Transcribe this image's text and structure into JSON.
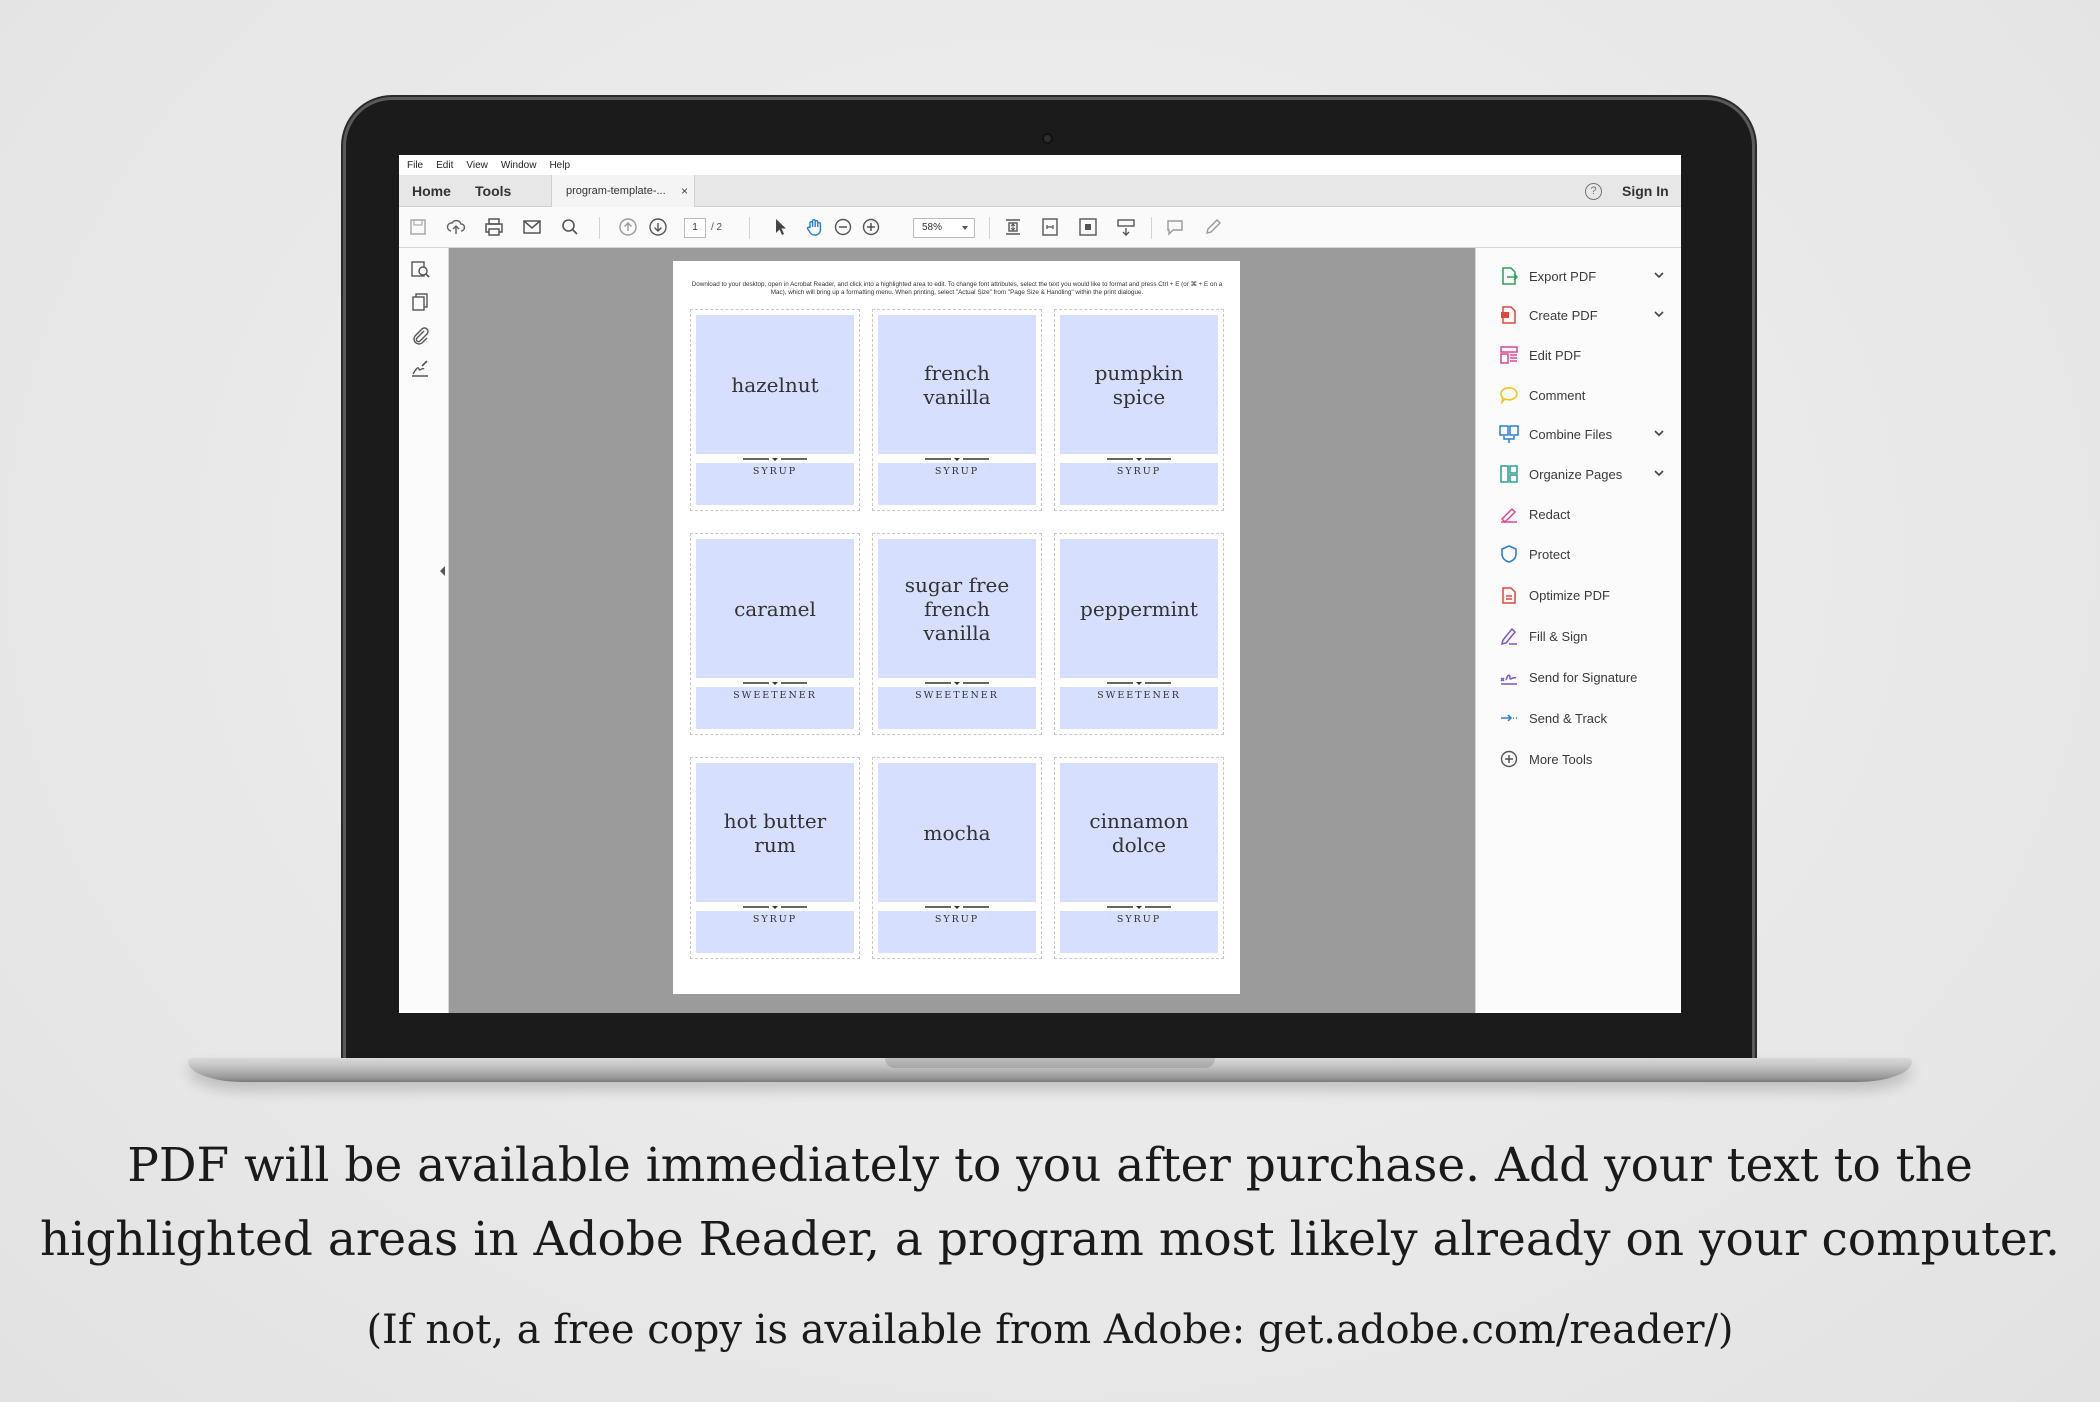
{
  "menu": [
    "File",
    "Edit",
    "View",
    "Window",
    "Help"
  ],
  "nav": {
    "home": "Home",
    "tools": "Tools"
  },
  "doc_tab": {
    "label": "program-template-...",
    "close": "×"
  },
  "help_icon_glyph": "?",
  "signin": "Sign In",
  "toolbar": {
    "page_current": "1",
    "page_total": "/ 2",
    "zoom": "58%"
  },
  "document": {
    "instructions": "Download to your desktop, open in Acrobat Reader, and click into a highlighted area to edit. To change font attributes, select the text you would like to format and press Ctrl + E (or ⌘ + E on a Mac), which will bring up a formatting menu.  When printing, select \"Actual Size\" from \"Page Size & Handling\" within the print dialogue.",
    "cards": [
      {
        "title": "hazelnut",
        "label": "SYRUP"
      },
      {
        "title": "french\nvanilla",
        "label": "SYRUP"
      },
      {
        "title": "pumpkin\nspice",
        "label": "SYRUP"
      },
      {
        "title": "caramel",
        "label": "SWEETENER"
      },
      {
        "title": "sugar free\nfrench\nvanilla",
        "label": "SWEETENER"
      },
      {
        "title": "peppermint",
        "label": "SWEETENER"
      },
      {
        "title": "hot butter\nrum",
        "label": "SYRUP"
      },
      {
        "title": "mocha",
        "label": "SYRUP"
      },
      {
        "title": "cinnamon\ndolce",
        "label": "SYRUP"
      }
    ],
    "highlight_color": "#d7dffe"
  },
  "tools_panel": [
    {
      "label": "Export PDF",
      "icon": "export-pdf-icon",
      "expandable": true,
      "color": "#2f9e5a"
    },
    {
      "label": "Create PDF",
      "icon": "create-pdf-icon",
      "expandable": true,
      "color": "#e0463c"
    },
    {
      "label": "Edit PDF",
      "icon": "edit-pdf-icon",
      "expandable": false,
      "color": "#e0468c"
    },
    {
      "label": "Comment",
      "icon": "comment-icon",
      "expandable": false,
      "color": "#f0c419"
    },
    {
      "label": "Combine Files",
      "icon": "combine-files-icon",
      "expandable": true,
      "color": "#2a7fd4"
    },
    {
      "label": "Organize Pages",
      "icon": "organize-pages-icon",
      "expandable": true,
      "color": "#2a9e8f"
    },
    {
      "label": "Redact",
      "icon": "redact-icon",
      "expandable": false,
      "color": "#e0468c"
    },
    {
      "label": "Protect",
      "icon": "protect-icon",
      "expandable": false,
      "color": "#2a7fd4"
    },
    {
      "label": "Optimize PDF",
      "icon": "optimize-pdf-icon",
      "expandable": false,
      "color": "#e0463c"
    },
    {
      "label": "Fill & Sign",
      "icon": "fill-sign-icon",
      "expandable": false,
      "color": "#7b55c7"
    },
    {
      "label": "Send for Signature",
      "icon": "send-for-signature-icon",
      "expandable": false,
      "color": "#7b55c7"
    },
    {
      "label": "Send & Track",
      "icon": "send-track-icon",
      "expandable": false,
      "color": "#2a7fd4"
    },
    {
      "label": "More Tools",
      "icon": "more-tools-icon",
      "expandable": false,
      "color": "#555555"
    }
  ],
  "caption": {
    "line1": "PDF will be available immediately to you after purchase.  Add your text to the",
    "line2": "highlighted areas in Adobe Reader, a program most likely already on your computer.",
    "line3": "(If not, a free copy is available from Adobe: get.adobe.com/reader/)"
  }
}
